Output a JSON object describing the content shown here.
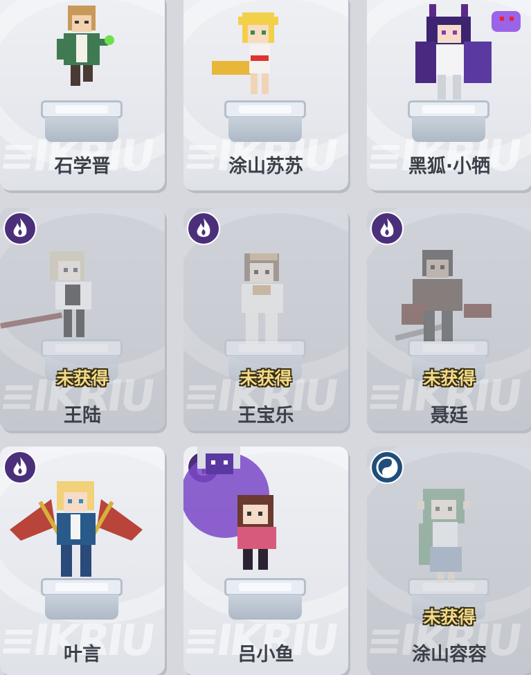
{
  "locked_label": "未获得",
  "colors": {
    "fire_badge": "#4b2f7a",
    "water_badge": "#1f4e7a",
    "card_bg": "#eef0f4",
    "locked_text": "#f2dc8a"
  },
  "cards": [
    {
      "name": "石学晋",
      "locked": false,
      "badge": null
    },
    {
      "name": "涂山苏苏",
      "locked": false,
      "badge": null
    },
    {
      "name": "黑狐·小牺",
      "locked": false,
      "badge": null
    },
    {
      "name": "王陆",
      "locked": true,
      "badge": "fire-icon"
    },
    {
      "name": "王宝乐",
      "locked": true,
      "badge": "fire-icon"
    },
    {
      "name": "聂廷",
      "locked": true,
      "badge": "fire-icon"
    },
    {
      "name": "叶言",
      "locked": false,
      "badge": "fire-icon"
    },
    {
      "name": "吕小鱼",
      "locked": false,
      "badge": "fire-icon"
    },
    {
      "name": "涂山容容",
      "locked": true,
      "badge": "water-icon"
    }
  ]
}
